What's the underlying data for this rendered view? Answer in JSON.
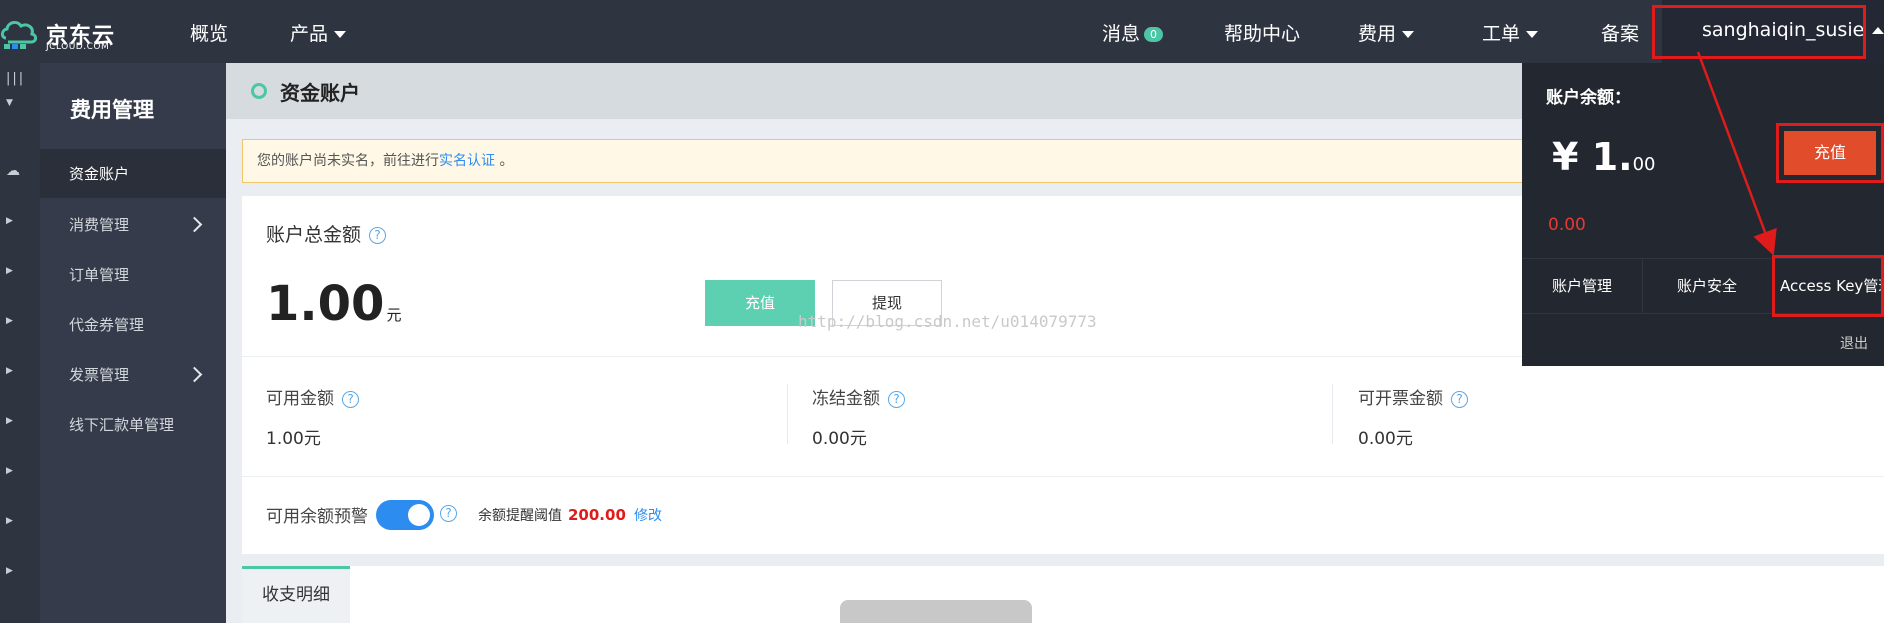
{
  "brand": {
    "name": "京东云",
    "sub": "JCLOUD.COM"
  },
  "nav": {
    "overview": "概览",
    "products": "产品",
    "messages": "消息",
    "messages_count": "0",
    "help": "帮助中心",
    "billing": "费用",
    "tickets": "工单",
    "filing": "备案",
    "username": "sanghaiqin_susie"
  },
  "sidebar": {
    "title": "费用管理",
    "items": [
      {
        "label": "资金账户"
      },
      {
        "label": "消费管理"
      },
      {
        "label": "订单管理"
      },
      {
        "label": "代金券管理"
      },
      {
        "label": "发票管理"
      },
      {
        "label": "线下汇款单管理"
      }
    ]
  },
  "page": {
    "title": "资金账户",
    "alert_prefix": "您的账户尚未实名，前往进行",
    "alert_link": "实名认证",
    "alert_suffix": "。"
  },
  "account": {
    "total_label": "账户总金额",
    "total_amount": "1.00",
    "total_unit": "元",
    "recharge": "充值",
    "withdraw": "提现",
    "watermark": "http://blog.csdn.net/u014079773",
    "available_label": "可用金额",
    "available_value": "1.00元",
    "frozen_label": "冻结金额",
    "frozen_value": "0.00元",
    "invoiceable_label": "可开票金额",
    "invoiceable_value": "0.00元",
    "warning_label": "可用余额预警",
    "warning_enabled": true,
    "threshold_label": "余额提醒阈值",
    "threshold_value": "200.00",
    "modify": "修改"
  },
  "tabs": {
    "details": "收支明细"
  },
  "dropdown": {
    "balance_title": "账户余额：",
    "currency": "¥",
    "balance_int": "1.",
    "balance_dec": "00",
    "recharge": "充值",
    "red_amount": "0.00",
    "links": [
      "账户管理",
      "账户安全",
      "Access Key管理"
    ],
    "logout": "退出"
  },
  "colors": {
    "topbar": "#2f3441",
    "accent_green": "#4cc7a5",
    "highlight_red": "#e01b1b",
    "link_blue": "#2d8cf0"
  }
}
